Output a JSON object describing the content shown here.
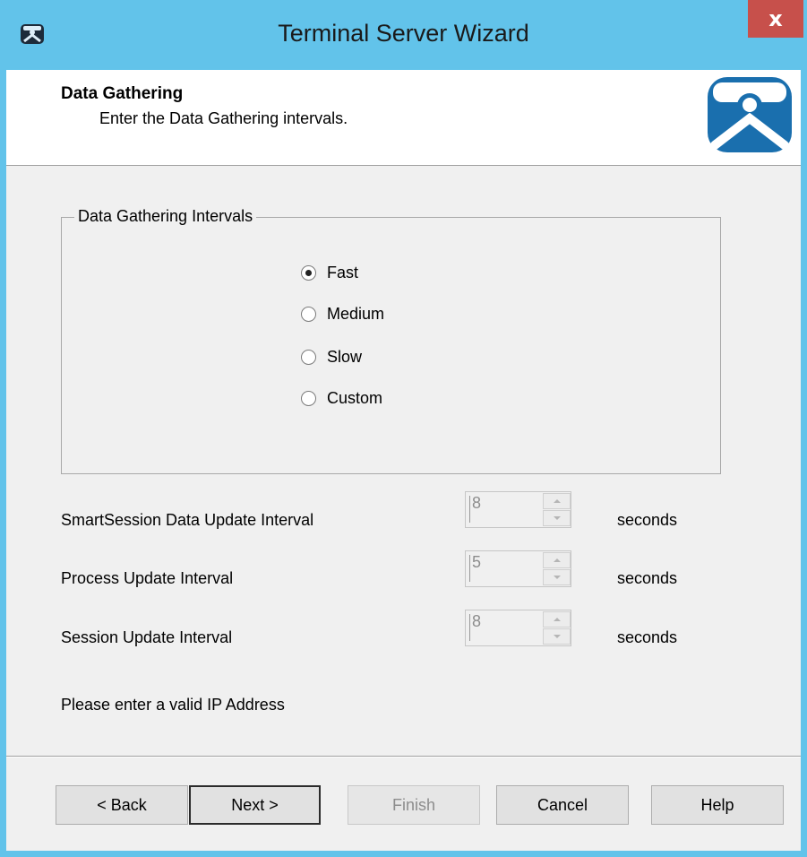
{
  "window": {
    "title": "Terminal Server Wizard",
    "close_glyph": "x",
    "titlebar_color": "#62c3ea",
    "close_color": "#c7504b",
    "app_icon": "thinmanager-icon"
  },
  "header": {
    "title": "Data Gathering",
    "subtitle": "Enter the Data Gathering intervals.",
    "logo_icon": "thinmanager-logo-icon",
    "logo_color": "#1a6fae"
  },
  "intervals_group": {
    "legend": "Data Gathering Intervals",
    "options": [
      {
        "label": "Fast",
        "selected": true
      },
      {
        "label": "Medium",
        "selected": false
      },
      {
        "label": "Slow",
        "selected": false
      },
      {
        "label": "Custom",
        "selected": false
      }
    ]
  },
  "fields": [
    {
      "label": "SmartSession Data Update Interval",
      "value": "8",
      "unit": "seconds",
      "enabled": false
    },
    {
      "label": "Process Update Interval",
      "value": "5",
      "unit": "seconds",
      "enabled": false
    },
    {
      "label": "Session Update Interval",
      "value": "8",
      "unit": "seconds",
      "enabled": false
    }
  ],
  "message": "Please enter a valid IP Address",
  "buttons": {
    "back": "< Back",
    "next": "Next >",
    "finish": "Finish",
    "cancel": "Cancel",
    "help": "Help"
  }
}
